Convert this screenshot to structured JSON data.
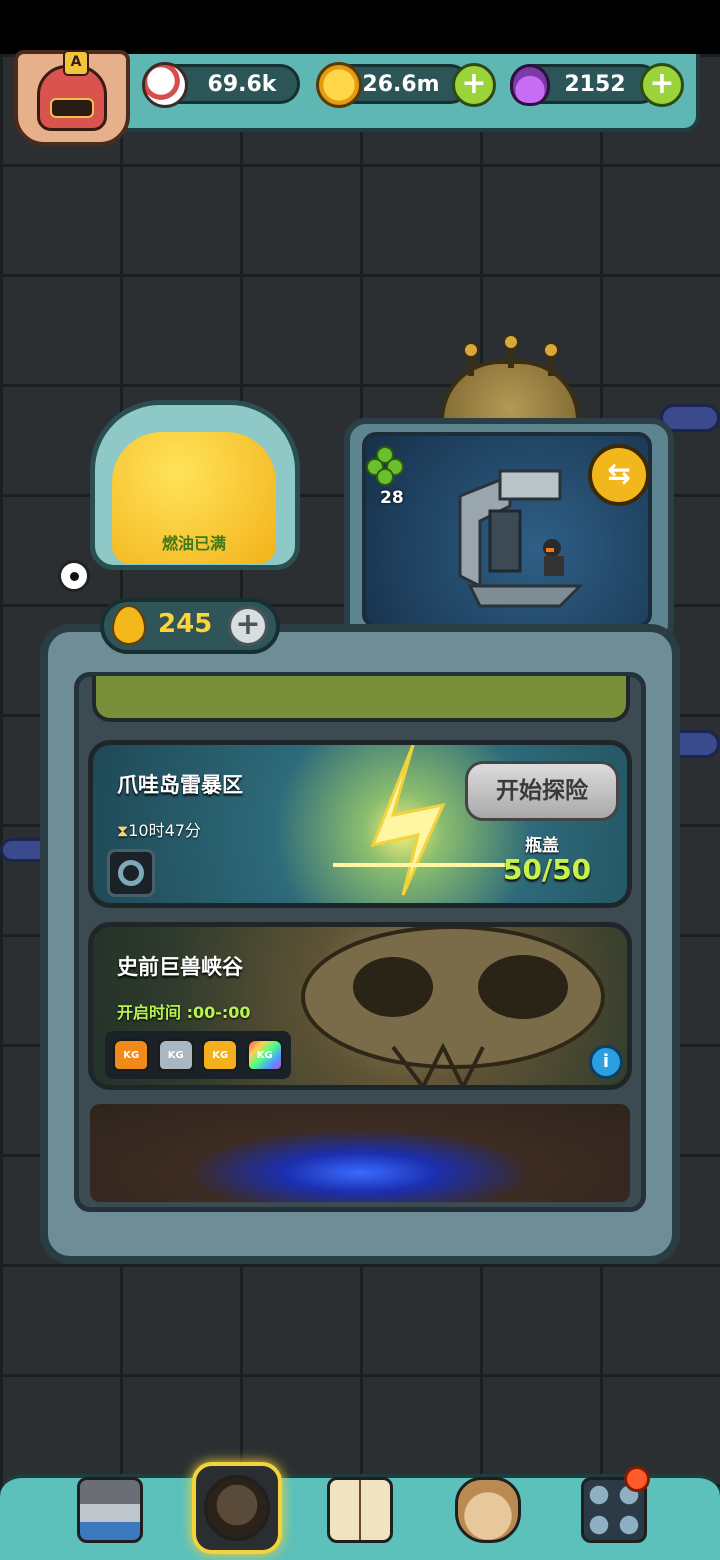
{
  "resources": {
    "eye": {
      "value": "69.6k",
      "icon": "eyeball-icon"
    },
    "coin": {
      "value": "26.6m",
      "icon": "gold-coin-icon"
    },
    "potion": {
      "value": "2152",
      "icon": "potion-flask-icon"
    }
  },
  "avatar": {
    "rank_letter": "A"
  },
  "fuel": {
    "tank_label": "燃油已满",
    "amount": "245"
  },
  "machine": {
    "clover_count": "28",
    "swap_symbol": "⇆"
  },
  "levels": [
    {
      "title": "爪哇岛雷暴区",
      "timer": "10时47分",
      "start_label": "开始探险",
      "cap_label": "瓶盖",
      "cap_value": "50/50"
    },
    {
      "title": "史前巨兽峡谷",
      "open_time": "开启时间 :00-:00",
      "weights": [
        {
          "label": "KG",
          "color": "#f08a1a"
        },
        {
          "label": "KG",
          "color": "#a9b7c2"
        },
        {
          "label": "KG",
          "color": "#f2b01c"
        },
        {
          "label": "KG",
          "color": "#b04fd8"
        }
      ],
      "info_symbol": "i"
    }
  ],
  "bottom_nav": [
    {
      "name": "shop",
      "icon": "shop-building-icon"
    },
    {
      "name": "monster",
      "icon": "monster-icon"
    },
    {
      "name": "book",
      "icon": "book-icon"
    },
    {
      "name": "bag",
      "icon": "money-bag-icon"
    },
    {
      "name": "menu",
      "icon": "grid-menu-icon"
    }
  ],
  "colors": {
    "accent": "#9bd33b",
    "frame": "#5fb7b4",
    "fuel": "#ffd43a",
    "cap": "#c8f24a"
  }
}
